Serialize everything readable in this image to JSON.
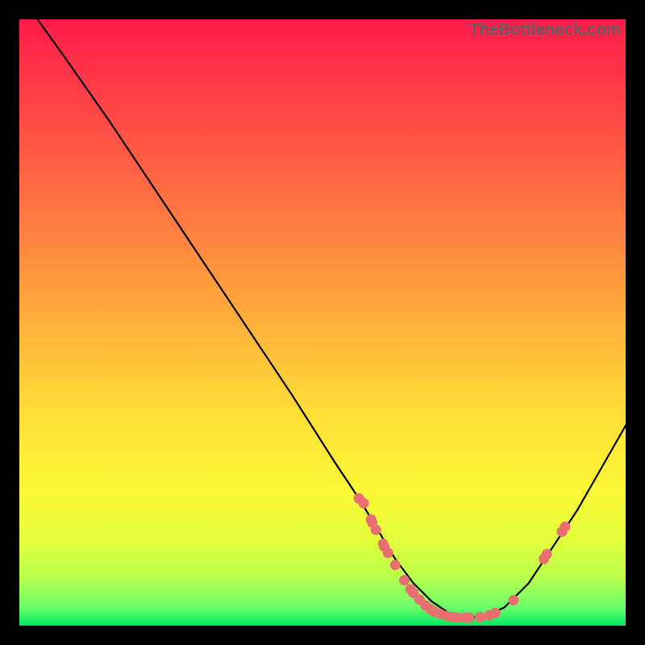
{
  "watermark": "TheBottleneck.com",
  "colors": {
    "marker": "#e76f6f",
    "curve": "#000000"
  },
  "chart_data": {
    "type": "line",
    "title": "",
    "xlabel": "",
    "ylabel": "",
    "xlim": [
      0,
      100
    ],
    "ylim": [
      0,
      100
    ],
    "curve_points": [
      {
        "x": 3,
        "y": 100
      },
      {
        "x": 8,
        "y": 93
      },
      {
        "x": 15,
        "y": 83
      },
      {
        "x": 25,
        "y": 68
      },
      {
        "x": 35,
        "y": 53
      },
      {
        "x": 45,
        "y": 38
      },
      {
        "x": 52,
        "y": 27
      },
      {
        "x": 56,
        "y": 21
      },
      {
        "x": 59,
        "y": 16
      },
      {
        "x": 62,
        "y": 11
      },
      {
        "x": 65,
        "y": 7
      },
      {
        "x": 68,
        "y": 4
      },
      {
        "x": 71,
        "y": 2
      },
      {
        "x": 74,
        "y": 1.3
      },
      {
        "x": 77,
        "y": 1.6
      },
      {
        "x": 80,
        "y": 3
      },
      {
        "x": 84,
        "y": 7
      },
      {
        "x": 88,
        "y": 13
      },
      {
        "x": 92,
        "y": 19
      },
      {
        "x": 96,
        "y": 26
      },
      {
        "x": 100,
        "y": 33
      }
    ],
    "markers": [
      {
        "x": 56.0,
        "y": 21.0
      },
      {
        "x": 56.8,
        "y": 20.2
      },
      {
        "x": 58.0,
        "y": 17.5
      },
      {
        "x": 58.2,
        "y": 17.0
      },
      {
        "x": 58.8,
        "y": 15.8
      },
      {
        "x": 60.0,
        "y": 13.5
      },
      {
        "x": 60.2,
        "y": 13.0
      },
      {
        "x": 60.8,
        "y": 12.0
      },
      {
        "x": 62.0,
        "y": 10.0
      },
      {
        "x": 63.5,
        "y": 7.5
      },
      {
        "x": 64.5,
        "y": 6.0
      },
      {
        "x": 65.0,
        "y": 5.4
      },
      {
        "x": 66.0,
        "y": 4.3
      },
      {
        "x": 67.0,
        "y": 3.3
      },
      {
        "x": 67.8,
        "y": 2.7
      },
      {
        "x": 68.5,
        "y": 2.3
      },
      {
        "x": 69.5,
        "y": 1.9
      },
      {
        "x": 70.5,
        "y": 1.6
      },
      {
        "x": 71.5,
        "y": 1.4
      },
      {
        "x": 72.2,
        "y": 1.3
      },
      {
        "x": 73.5,
        "y": 1.3
      },
      {
        "x": 74.2,
        "y": 1.3
      },
      {
        "x": 76.0,
        "y": 1.4
      },
      {
        "x": 77.5,
        "y": 1.7
      },
      {
        "x": 78.5,
        "y": 2.1
      },
      {
        "x": 81.5,
        "y": 4.2
      },
      {
        "x": 86.5,
        "y": 11.0
      },
      {
        "x": 87.0,
        "y": 11.8
      },
      {
        "x": 89.5,
        "y": 15.5
      },
      {
        "x": 90.0,
        "y": 16.3
      }
    ]
  }
}
